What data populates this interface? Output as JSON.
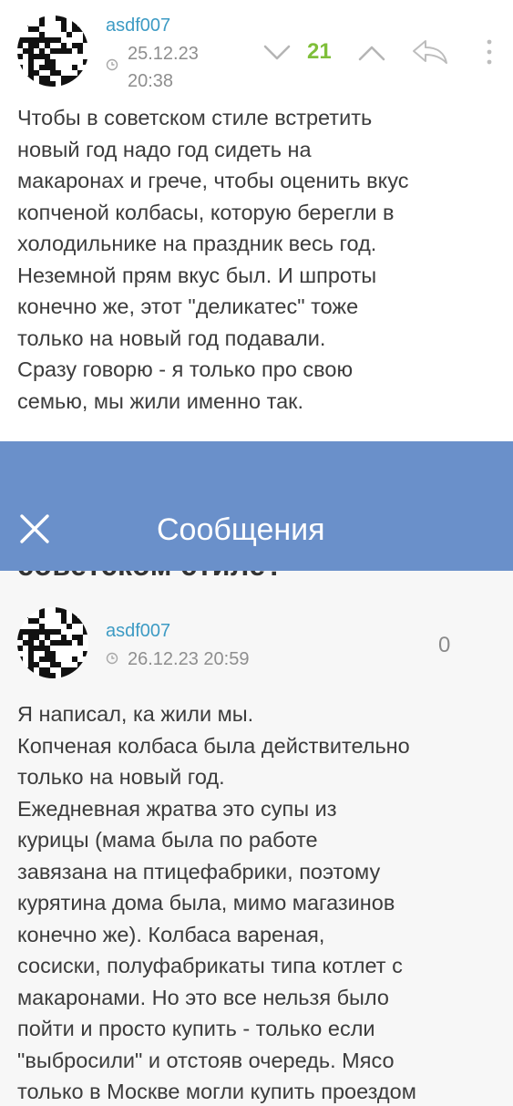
{
  "comment1": {
    "username": "asdf007",
    "date_line1": "25.12.23",
    "date_line2": "20:38",
    "score": "21",
    "text": "Чтобы в советском стиле встретить\nновый год надо год сидеть на\nмакаронах и грече, чтобы оценить вкус\nкопченой колбасы, которую берегли в\nхолодильнике на праздник весь год.\nНеземной прям вкус был. И шпроты\nконечно же, этот \"деликатес\" тоже\nтолько на новый год подавали.\nСразу говорю - я только про свою\nсемью, мы жили именно так."
  },
  "header": {
    "title": "Сообщения"
  },
  "post_title_cut": "советском стиле?",
  "comment2": {
    "username": "asdf007",
    "date": "26.12.23 20:59",
    "score": "0",
    "text": "Я написал, ка жили мы.\nКопченая колбаса была действительно\nтолько на новый год.\nЕжедневная жратва это супы из\nкурицы (мама была по работе\nзавязана на птицефабрики, поэтому\nкурятина дома была, мимо магазинов\nконечно же). Колбаса вареная,\nсосиски, полуфабрикаты типа котлет с\nмакаронами. Но это все нельзя было\nпойти и просто купить - только если\n\"выбросили\" и отстояв очередь. Мясо\nтолько в Москве могли купить проездом"
  },
  "colors": {
    "username": "#3d9bc4",
    "score_positive": "#7fbf3a",
    "header_bg": "#6a90ca"
  },
  "icons": {
    "downvote": "chevron-down-icon",
    "upvote": "chevron-up-icon",
    "reply": "reply-arrow-icon",
    "more": "more-vertical-icon",
    "close": "close-icon",
    "clock": "clock-icon"
  }
}
